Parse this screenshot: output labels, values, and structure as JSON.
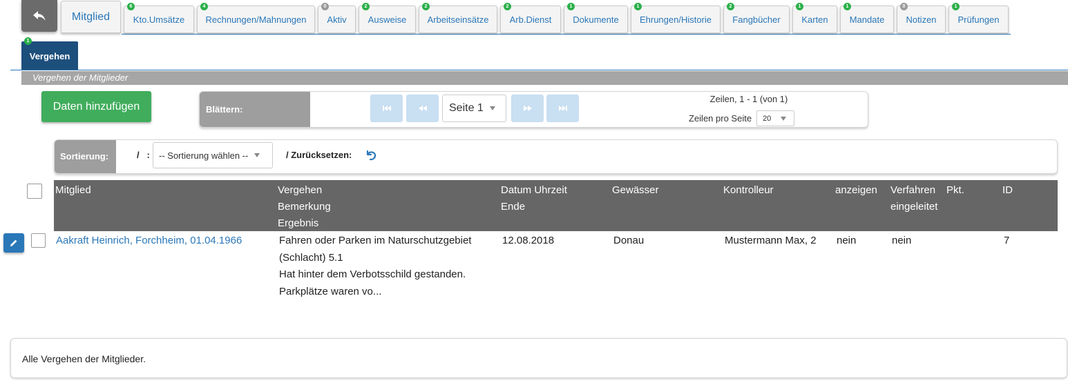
{
  "tabs": [
    {
      "label": "Mitglied",
      "badge": ""
    },
    {
      "label": "Kto.Umsätze",
      "badge": "6"
    },
    {
      "label": "Rechnungen/Mahnungen",
      "badge": "4"
    },
    {
      "label": "Aktiv",
      "badge": "0"
    },
    {
      "label": "Ausweise",
      "badge": "2"
    },
    {
      "label": "Arbeitseinsätze",
      "badge": "2"
    },
    {
      "label": "Arb.Dienst",
      "badge": "2"
    },
    {
      "label": "Dokumente",
      "badge": "1"
    },
    {
      "label": "Ehrungen/Historie",
      "badge": "1"
    },
    {
      "label": "Fangbücher",
      "badge": "2"
    },
    {
      "label": "Karten",
      "badge": "1"
    },
    {
      "label": "Mandate",
      "badge": "1"
    },
    {
      "label": "Notizen",
      "badge": "0"
    },
    {
      "label": "Prüfungen",
      "badge": "1"
    }
  ],
  "active_tab": {
    "label": "Vergehen",
    "badge": "1"
  },
  "section_title": "Vergehen der Mitglieder",
  "add_button": "Daten hinzufügen",
  "pager": {
    "label": "Blättern:",
    "page": "Seite 1",
    "rows_info": "Zeilen, 1 - 1 (von 1)",
    "rows_per_page_label": "Zeilen pro Seite",
    "rows_per_page": "20"
  },
  "sort": {
    "label": "Sortierung:",
    "separator": "/   :",
    "placeholder": "-- Sortierung wählen --",
    "reset_label": "/ Zurücksetzen:"
  },
  "table": {
    "columns": {
      "mitglied": "Mitglied",
      "vergehen": "Vergehen",
      "bemerkung": "Bemerkung",
      "ergebnis": "Ergebnis",
      "datum": "Datum Uhrzeit",
      "ende": "Ende",
      "gewaesser": "Gewässer",
      "kontrolleur": "Kontrolleur",
      "anzeigen": "anzeigen",
      "verfahren": "Verfahren",
      "eingeleitet": "eingeleitet",
      "pkt": "Pkt.",
      "id": "ID"
    },
    "rows": [
      {
        "mitglied": "Aakraft Heinrich, Forchheim, 01.04.1966",
        "vergehen_1": "Fahren oder Parken im Naturschutzgebiet",
        "vergehen_2": "(Schlacht) 5.1",
        "bemerkung_1": "Hat hinter dem Verbotsschild gestanden.",
        "bemerkung_2": "Parkplätze waren vo...",
        "datum": "12.08.2018",
        "gewaesser": "Donau",
        "kontrolleur": "Mustermann Max, 2",
        "anzeigen": "nein",
        "verfahren": "nein",
        "pkt": "",
        "id": "7"
      }
    ]
  },
  "footer": "Alle Vergehen der Mitglieder.",
  "colors": {
    "accent": "#2a77b8",
    "badge": "#2bb04a",
    "active_tab": "#1d4f7c",
    "add_button": "#40ad5c",
    "table_header": "#666666"
  }
}
